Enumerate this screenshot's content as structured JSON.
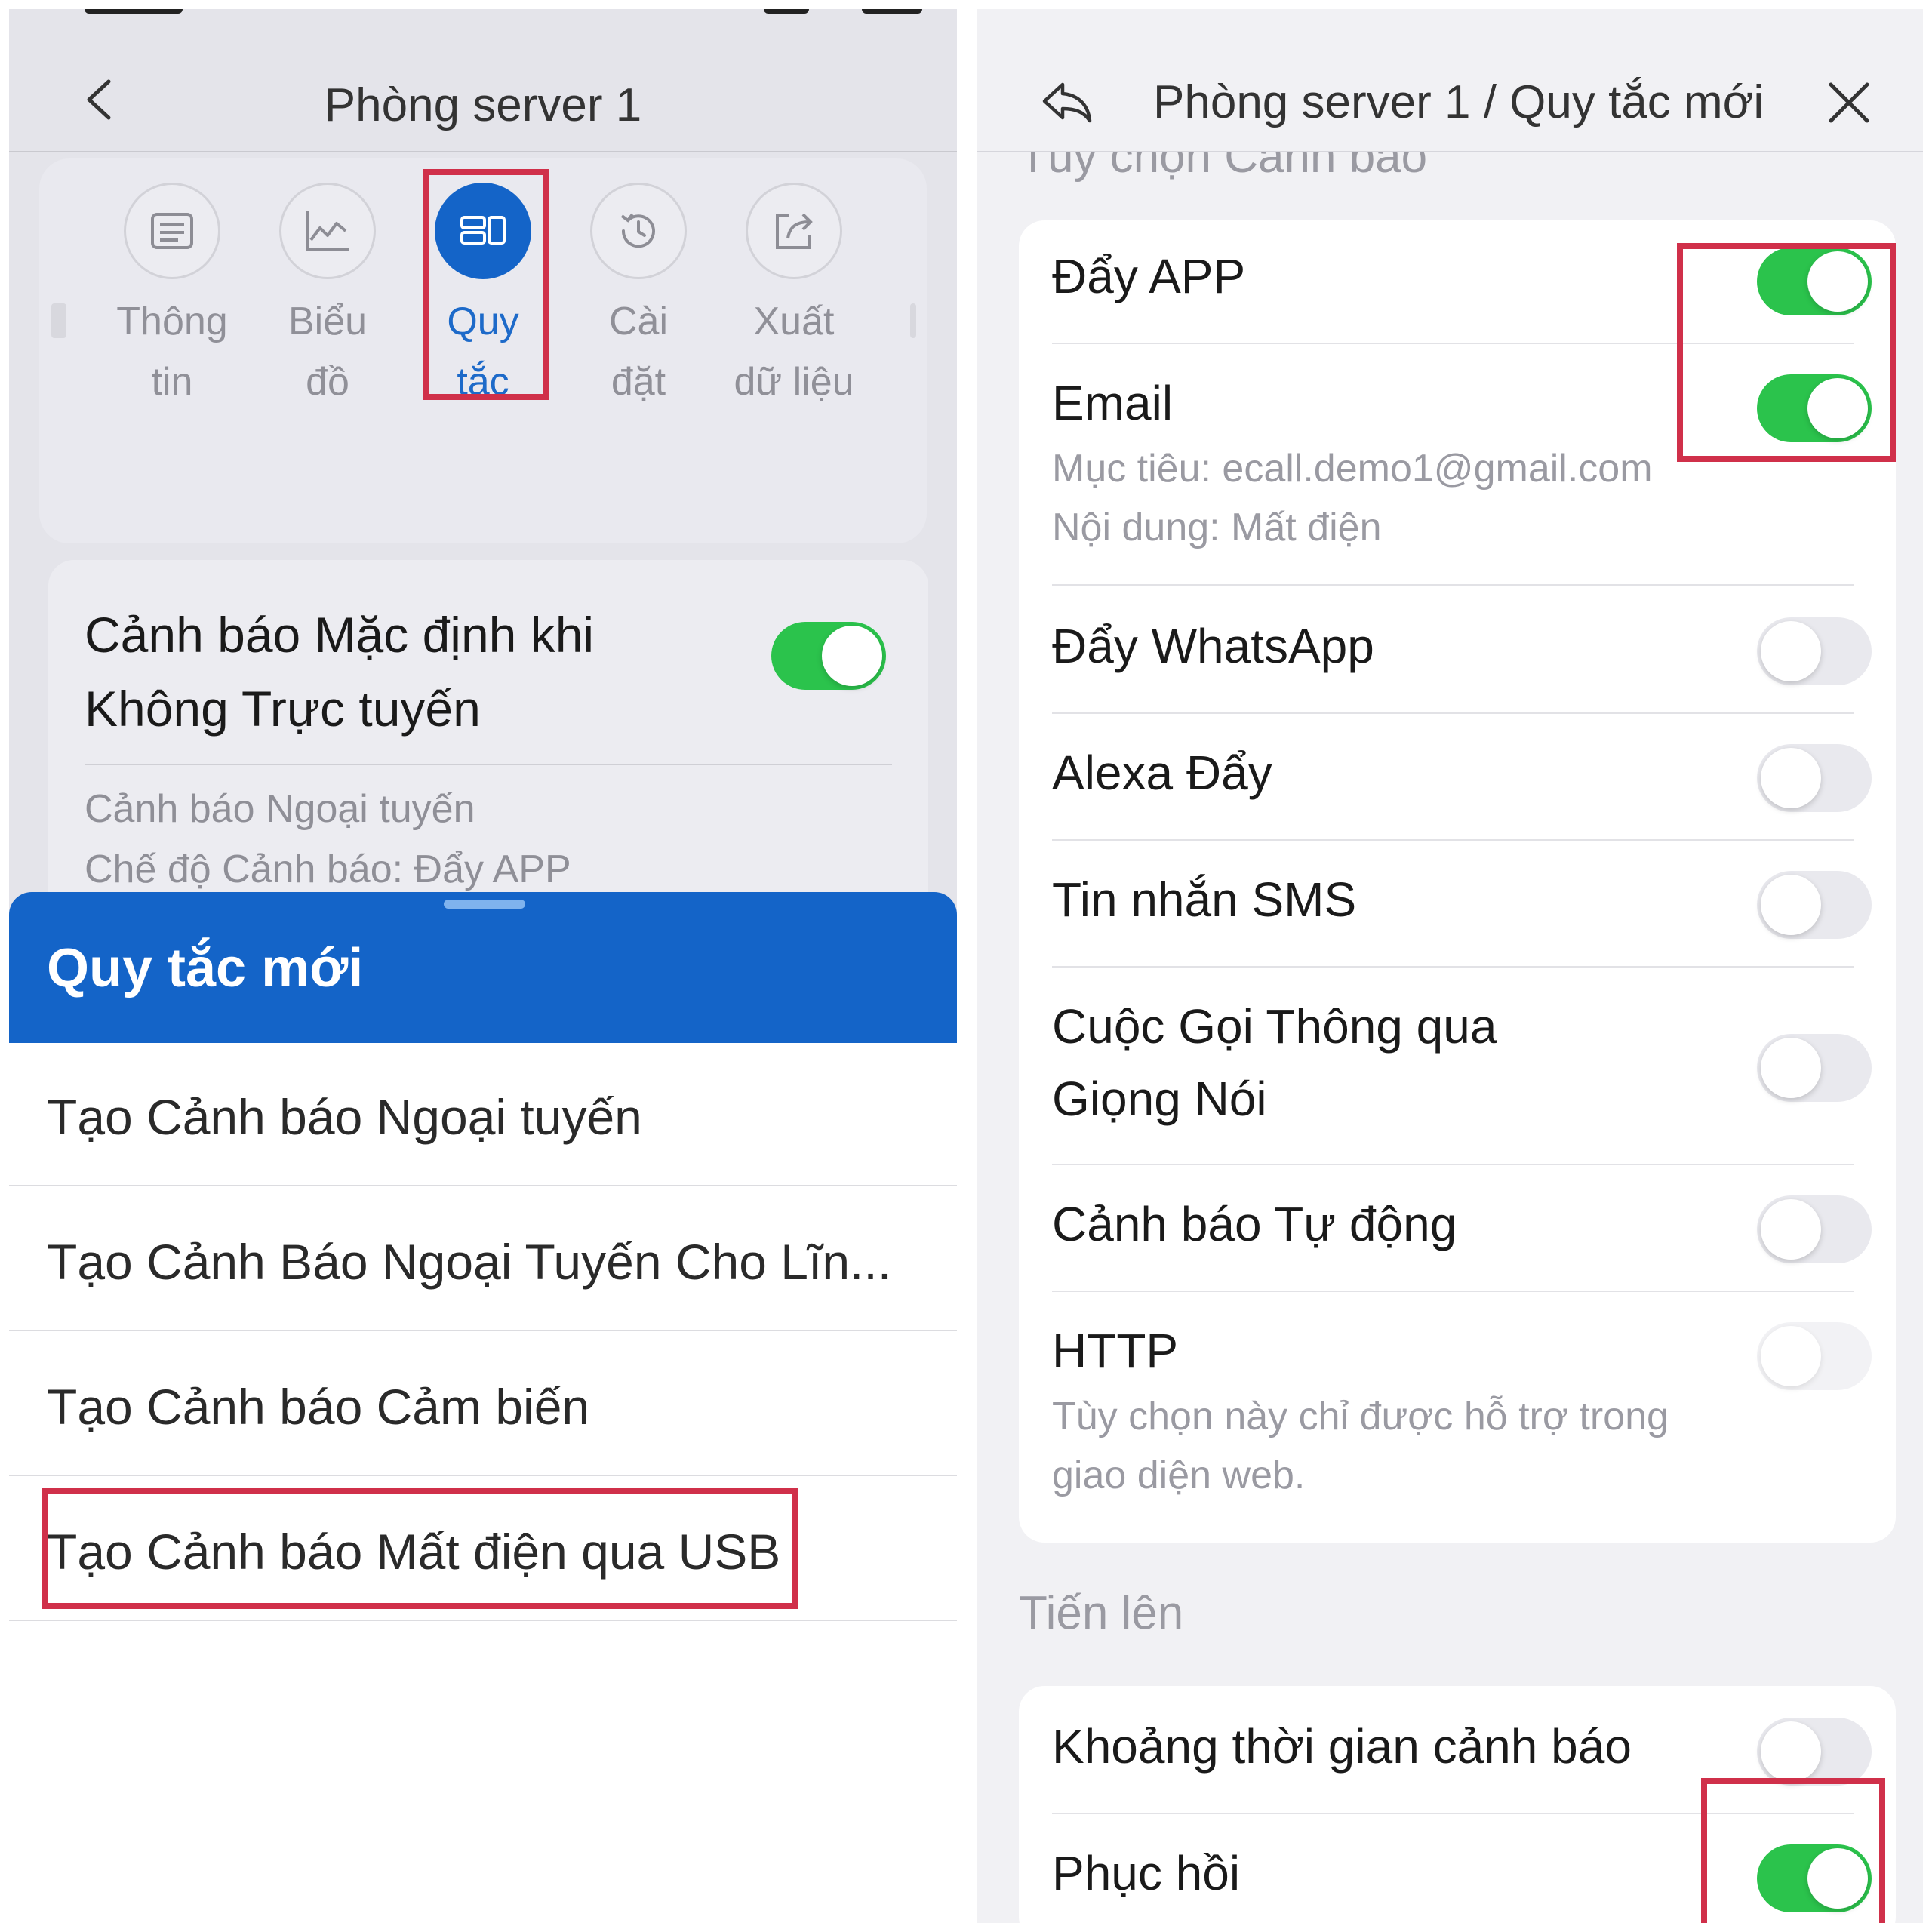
{
  "left": {
    "nav_title": "Phòng server 1",
    "tabs": [
      {
        "label": "Thông\ntin",
        "icon": "list-icon"
      },
      {
        "label": "Biểu\nđồ",
        "icon": "chart-icon"
      },
      {
        "label": "Quy\ntắc",
        "icon": "rules-icon",
        "active": true
      },
      {
        "label": "Cài\nđặt",
        "icon": "history-icon"
      },
      {
        "label": "Xuất\ndữ liệu",
        "icon": "export-icon"
      }
    ],
    "default_rule": {
      "title": "Cảnh báo Mặc định khi Không Trực tuyến",
      "enabled": true,
      "line1": "Cảnh báo Ngoại tuyến",
      "line2": "Chế độ Cảnh báo: Đẩy APP"
    },
    "sheet": {
      "title": "Quy tắc mới",
      "items": [
        "Tạo Cảnh báo Ngoại tuyến",
        "Tạo Cảnh Báo Ngoại Tuyến Cho Lĩn...",
        "Tạo Cảnh báo Cảm biến",
        "Tạo Cảnh báo Mất điện qua USB"
      ]
    }
  },
  "right": {
    "title": "Phòng server 1 / Quy tắc mới",
    "section_cut": "Tùy chọn Cảnh báo",
    "options": [
      {
        "label": "Đẩy APP",
        "on": true
      },
      {
        "label": "Email",
        "on": true,
        "sub1": "Mục tiêu: ecall.demo1@gmail.com",
        "sub2": "Nội dung: Mất điện"
      },
      {
        "label": "Đẩy WhatsApp",
        "on": false
      },
      {
        "label": "Alexa Đẩy",
        "on": false
      },
      {
        "label": "Tin nhắn SMS",
        "on": false
      },
      {
        "label": "Cuộc Gọi Thông qua",
        "label2": "Giọng Nói",
        "on": false
      },
      {
        "label": "Cảnh báo Tự động",
        "on": false
      },
      {
        "label": "HTTP",
        "on": false,
        "sub1": "Tùy chọn này chỉ được hỗ trợ trong",
        "sub2": "giao diện web."
      }
    ],
    "advanced_title": "Tiến lên",
    "advanced": [
      {
        "label": "Khoảng thời gian cảnh báo",
        "on": false
      },
      {
        "label": "Phục hồi",
        "on": true
      }
    ]
  },
  "colors": {
    "accent": "#1464c8",
    "toggle_on": "#2bc34c",
    "highlight": "#d0304a"
  }
}
